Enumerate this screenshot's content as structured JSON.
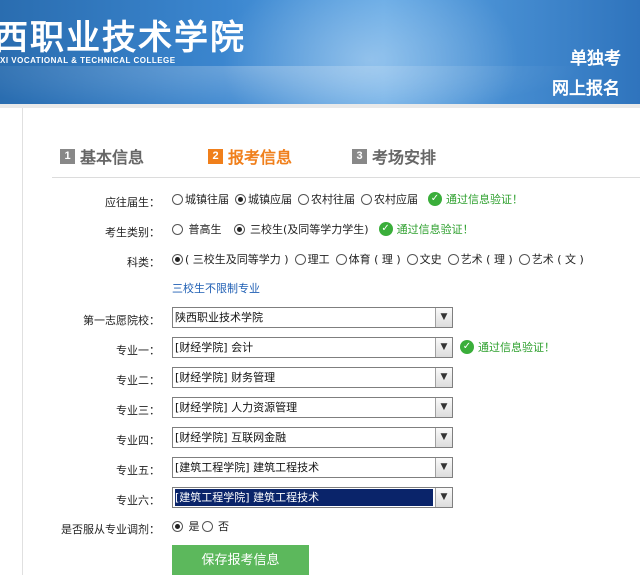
{
  "header": {
    "school_name": "西职业技术学院",
    "school_en": "XI VOCATIONAL & TECHNICAL COLLEGE",
    "title_line1": "单独考",
    "title_line2": "网上报名"
  },
  "steps": [
    {
      "num": "1",
      "label": "基本信息",
      "active": false
    },
    {
      "num": "2",
      "label": "报考信息",
      "active": true
    },
    {
      "num": "3",
      "label": "考场安排",
      "active": false
    }
  ],
  "form": {
    "graduate_type": {
      "label": "应往届生：",
      "options": [
        "城镇往届",
        "城镇应届",
        "农村往届",
        "农村应届"
      ],
      "selected_index": 1,
      "verified_text": "通过信息验证！"
    },
    "candidate_type": {
      "label": "考生类别：",
      "options": [
        "普高生",
        "三校生(及同等学力学生)"
      ],
      "selected_index": 1,
      "verified_text": "通过信息验证！"
    },
    "subject": {
      "label": "科类：",
      "options": [
        "( 三校生及同等学力 )",
        "理工",
        "体育 ( 理 )",
        "文史",
        "艺术 ( 理 )",
        "艺术 ( 文 )"
      ],
      "selected_index": 0
    },
    "unrestricted_note": "三校生不限制专业",
    "first_choice_school": {
      "label": "第一志愿院校：",
      "value": "陕西职业技术学院"
    },
    "majors": [
      {
        "label": "专业一：",
        "value": "[财经学院] 会计",
        "verified_text": "通过信息验证！"
      },
      {
        "label": "专业二：",
        "value": "[财经学院] 财务管理"
      },
      {
        "label": "专业三：",
        "value": "[财经学院] 人力资源管理"
      },
      {
        "label": "专业四：",
        "value": "[财经学院] 互联网金融"
      },
      {
        "label": "专业五：",
        "value": "[建筑工程学院] 建筑工程技术"
      },
      {
        "label": "专业六：",
        "value": "[建筑工程学院] 建筑工程技术"
      }
    ],
    "adjustment": {
      "label": "是否服从专业调剂：",
      "options": [
        "是",
        "否"
      ],
      "selected_index": 0
    },
    "save_label": "保存报考信息"
  },
  "colors": {
    "banner": "#3b86cf",
    "active_step": "#f07f1b",
    "verified": "#2ea02e",
    "link": "#1f5fb4",
    "save_button": "#5cb85c"
  },
  "icons": {
    "verified": "check-circle-icon",
    "dropdown": "chevron-down-icon"
  }
}
